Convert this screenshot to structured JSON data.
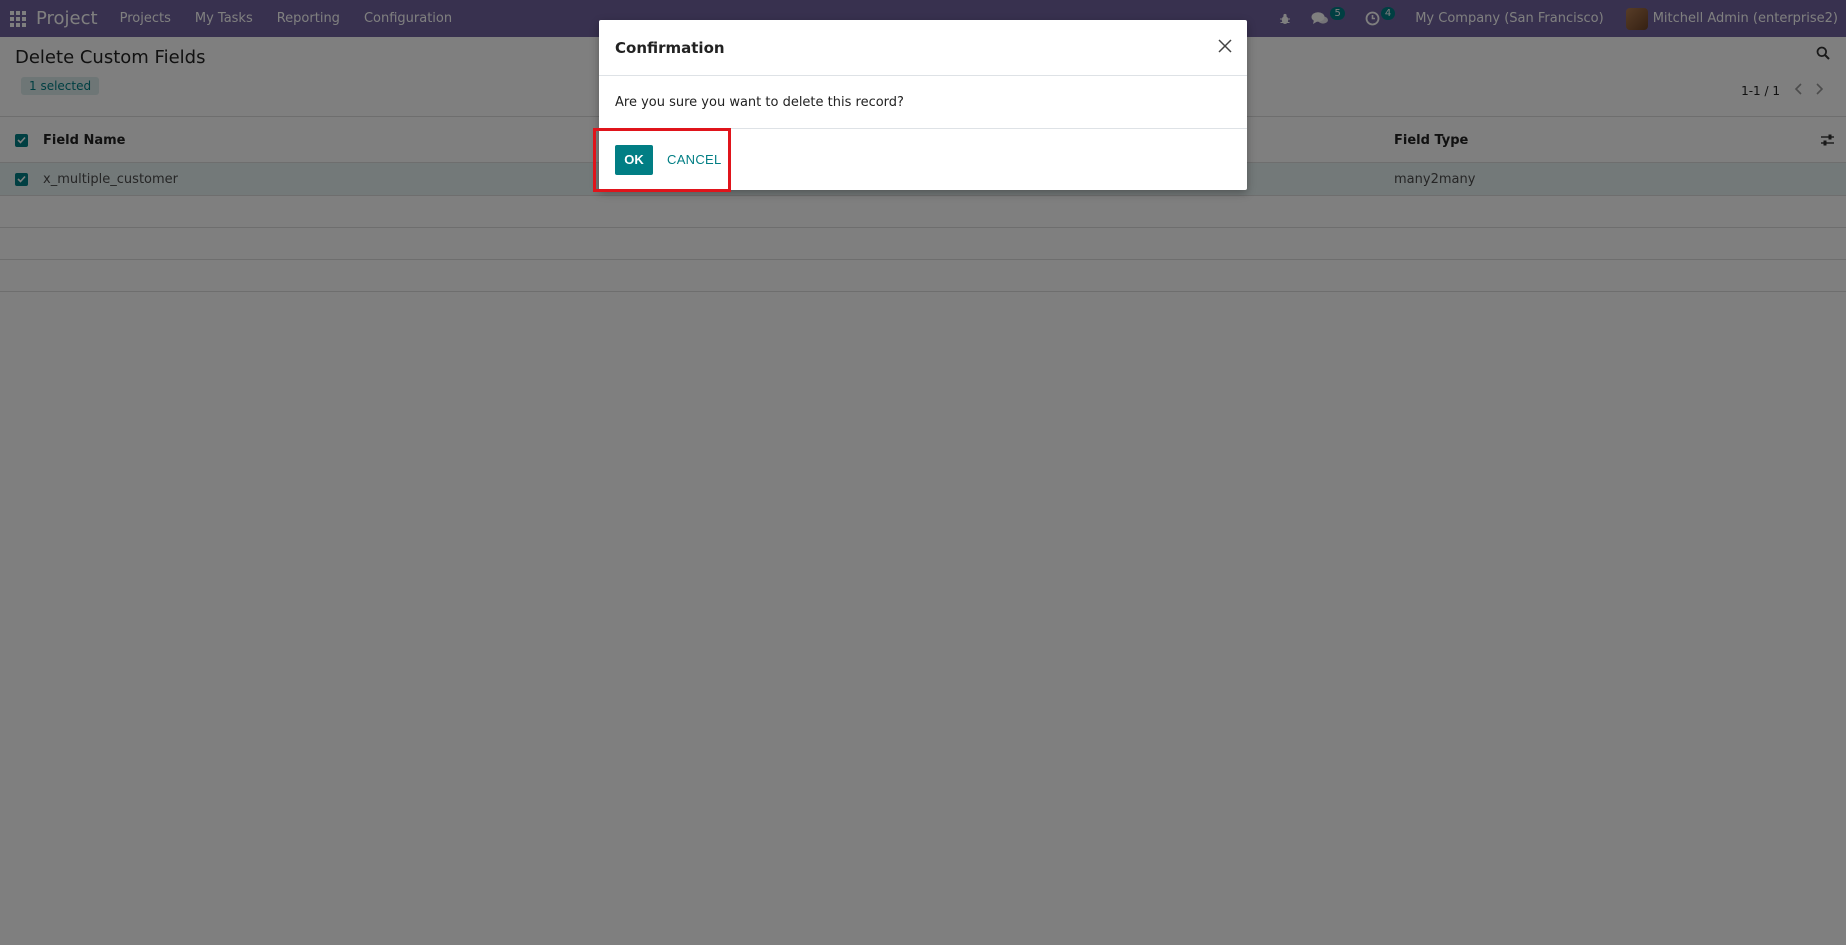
{
  "navbar": {
    "app_name": "Project",
    "menu": [
      "Projects",
      "My Tasks",
      "Reporting",
      "Configuration"
    ],
    "messages_count": "5",
    "activities_count": "4",
    "company": "My Company (San Francisco)",
    "user": "Mitchell Admin (enterprise2)"
  },
  "control_panel": {
    "title": "Delete Custom Fields",
    "selected": "1 selected",
    "pager": "1-1 / 1"
  },
  "list": {
    "columns": {
      "name": "Field Name",
      "type": "Field Type"
    },
    "rows": [
      {
        "name": "x_multiple_customer",
        "type": "many2many",
        "selected": true
      }
    ]
  },
  "dialog": {
    "title": "Confirmation",
    "message": "Are you sure you want to delete this record?",
    "ok_label": "OK",
    "cancel_label": "CANCEL"
  },
  "colors": {
    "navbar": "#71639e",
    "accent": "#017e84",
    "highlight": "#e0141b"
  }
}
